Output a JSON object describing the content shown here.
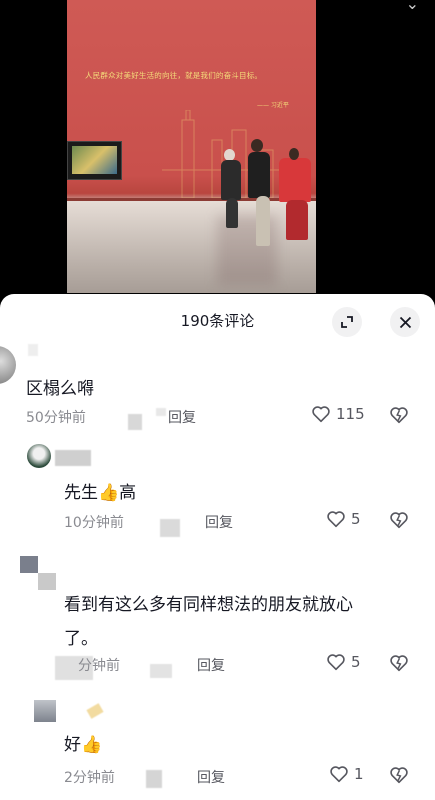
{
  "video": {
    "slogan": "人民群众对美好生活的向往，就是我们的奋斗目标。",
    "signature": "—— 习近平"
  },
  "header": {
    "title": "190条评论",
    "expand_icon": "expand-icon",
    "close_icon": "close-icon"
  },
  "comments": [
    {
      "text": "区榻么嘚",
      "time": "50分钟前",
      "reply": "回复",
      "likes": "115"
    },
    {
      "text_before": "先生",
      "text_after": "高",
      "time": "10分钟前",
      "reply": "回复",
      "likes": "5"
    },
    {
      "text_line1": "看到有这么多有同样想法的朋友就放心",
      "text_line2": "了。",
      "time": "分钟前",
      "reply": "回复",
      "likes": "5"
    },
    {
      "text_before": "好",
      "time": "2分钟前",
      "reply": "回复",
      "likes": "1"
    }
  ],
  "colors": {
    "text": "#161823",
    "meta": "#8a8b91",
    "accent": "#fe2c55"
  }
}
